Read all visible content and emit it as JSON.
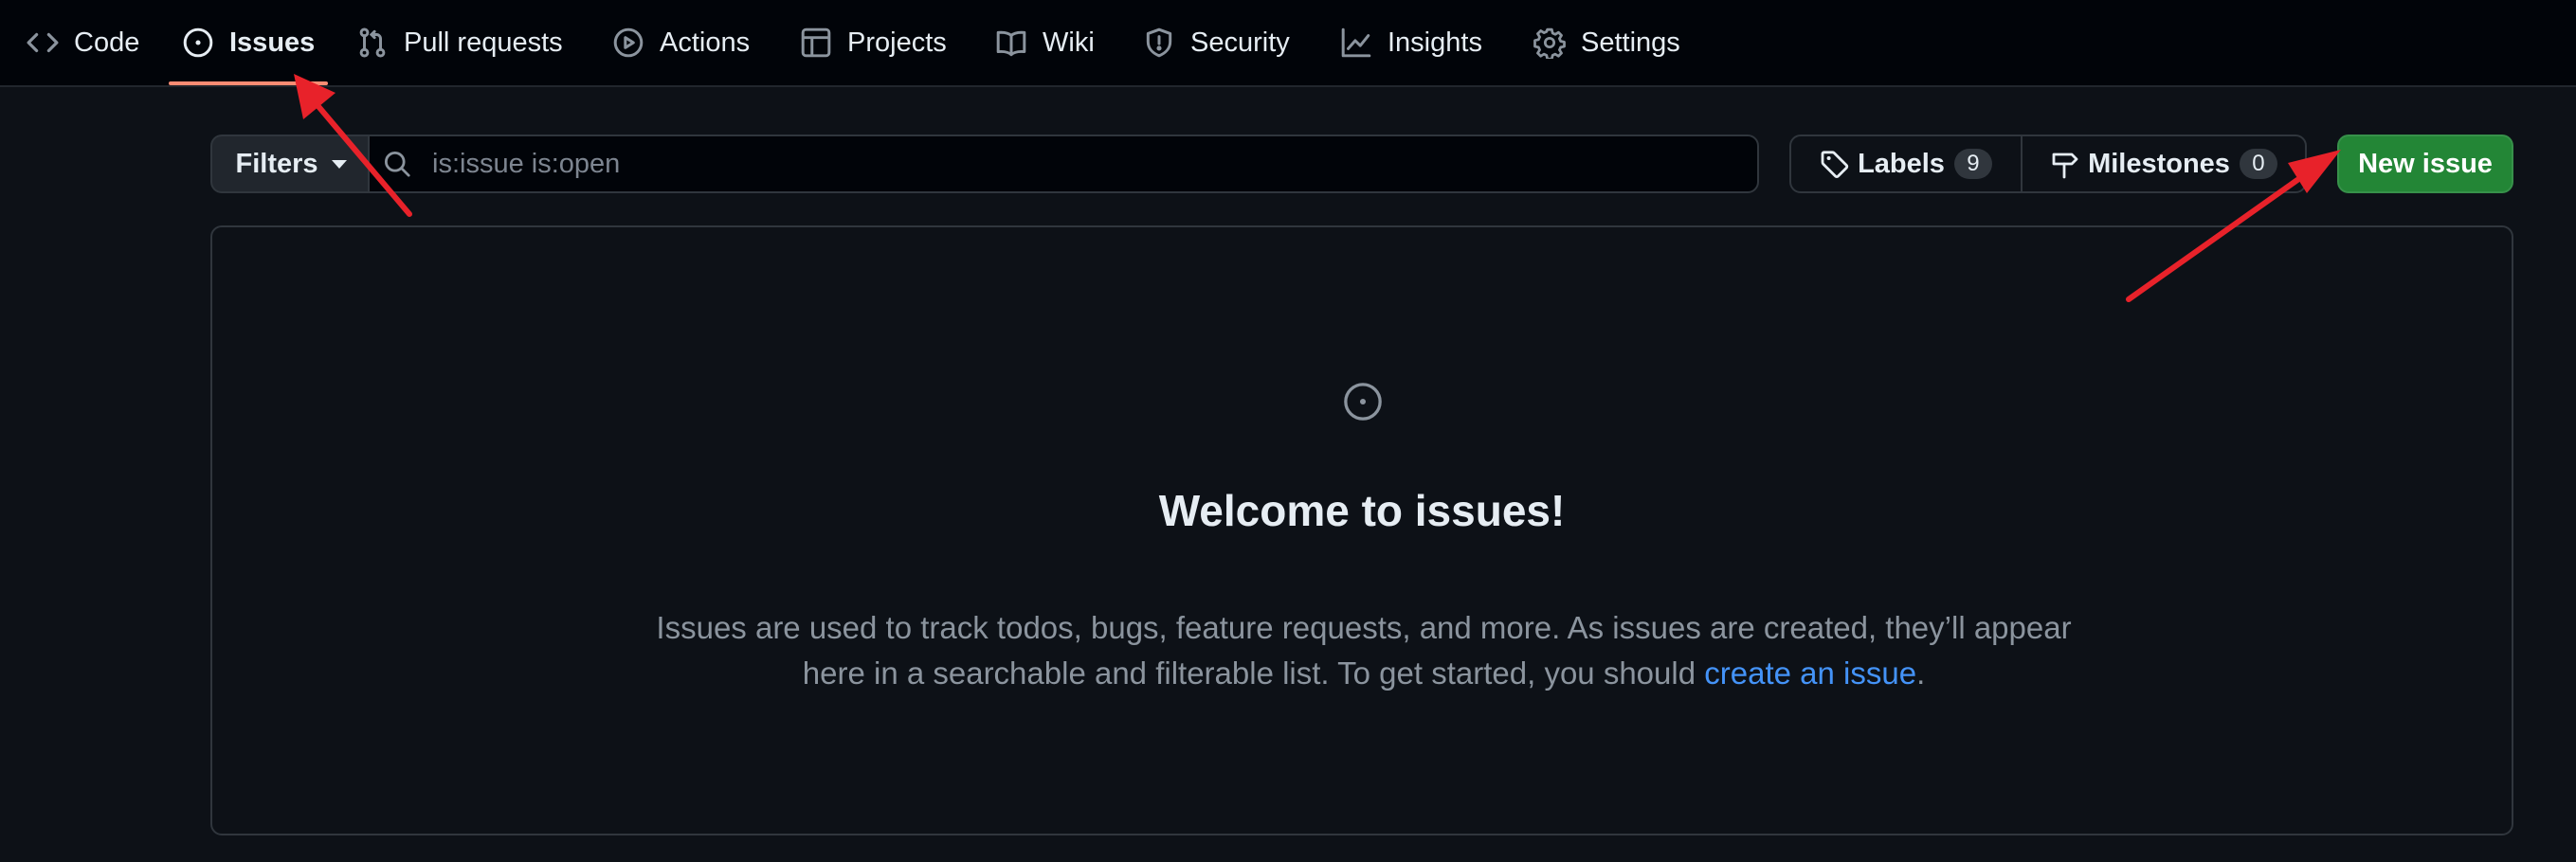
{
  "repo_nav": {
    "items": [
      {
        "label": "Code",
        "icon": "code-icon"
      },
      {
        "label": "Issues",
        "icon": "issue-opened-icon",
        "selected": true
      },
      {
        "label": "Pull requests",
        "icon": "git-pull-request-icon"
      },
      {
        "label": "Actions",
        "icon": "play-icon"
      },
      {
        "label": "Projects",
        "icon": "table-icon"
      },
      {
        "label": "Wiki",
        "icon": "book-icon"
      },
      {
        "label": "Security",
        "icon": "shield-icon"
      },
      {
        "label": "Insights",
        "icon": "graph-icon"
      },
      {
        "label": "Settings",
        "icon": "gear-icon"
      }
    ],
    "selected_underline_color": "#fd8c73"
  },
  "toolbar": {
    "filters_label": "Filters",
    "search_placeholder": "is:issue is:open",
    "labels_label": "Labels",
    "labels_count": "9",
    "milestones_label": "Milestones",
    "milestones_count": "0",
    "new_issue_label": "New issue",
    "new_issue_color": "#238636"
  },
  "blankslate": {
    "icon": "issue-opened-icon",
    "title": "Welcome to issues!",
    "description_before": "Issues are used to track todos, bugs, feature requests, and more. As issues are created, they’ll appear here in a searchable and filterable list. To get started, you should ",
    "link_text": "create an issue",
    "description_after": ".",
    "link_color": "#4493f8"
  },
  "annotations": {
    "arrow_color": "#e8222a",
    "arrows": [
      "arrow-to-issues-tab",
      "arrow-to-new-issue-button"
    ]
  }
}
